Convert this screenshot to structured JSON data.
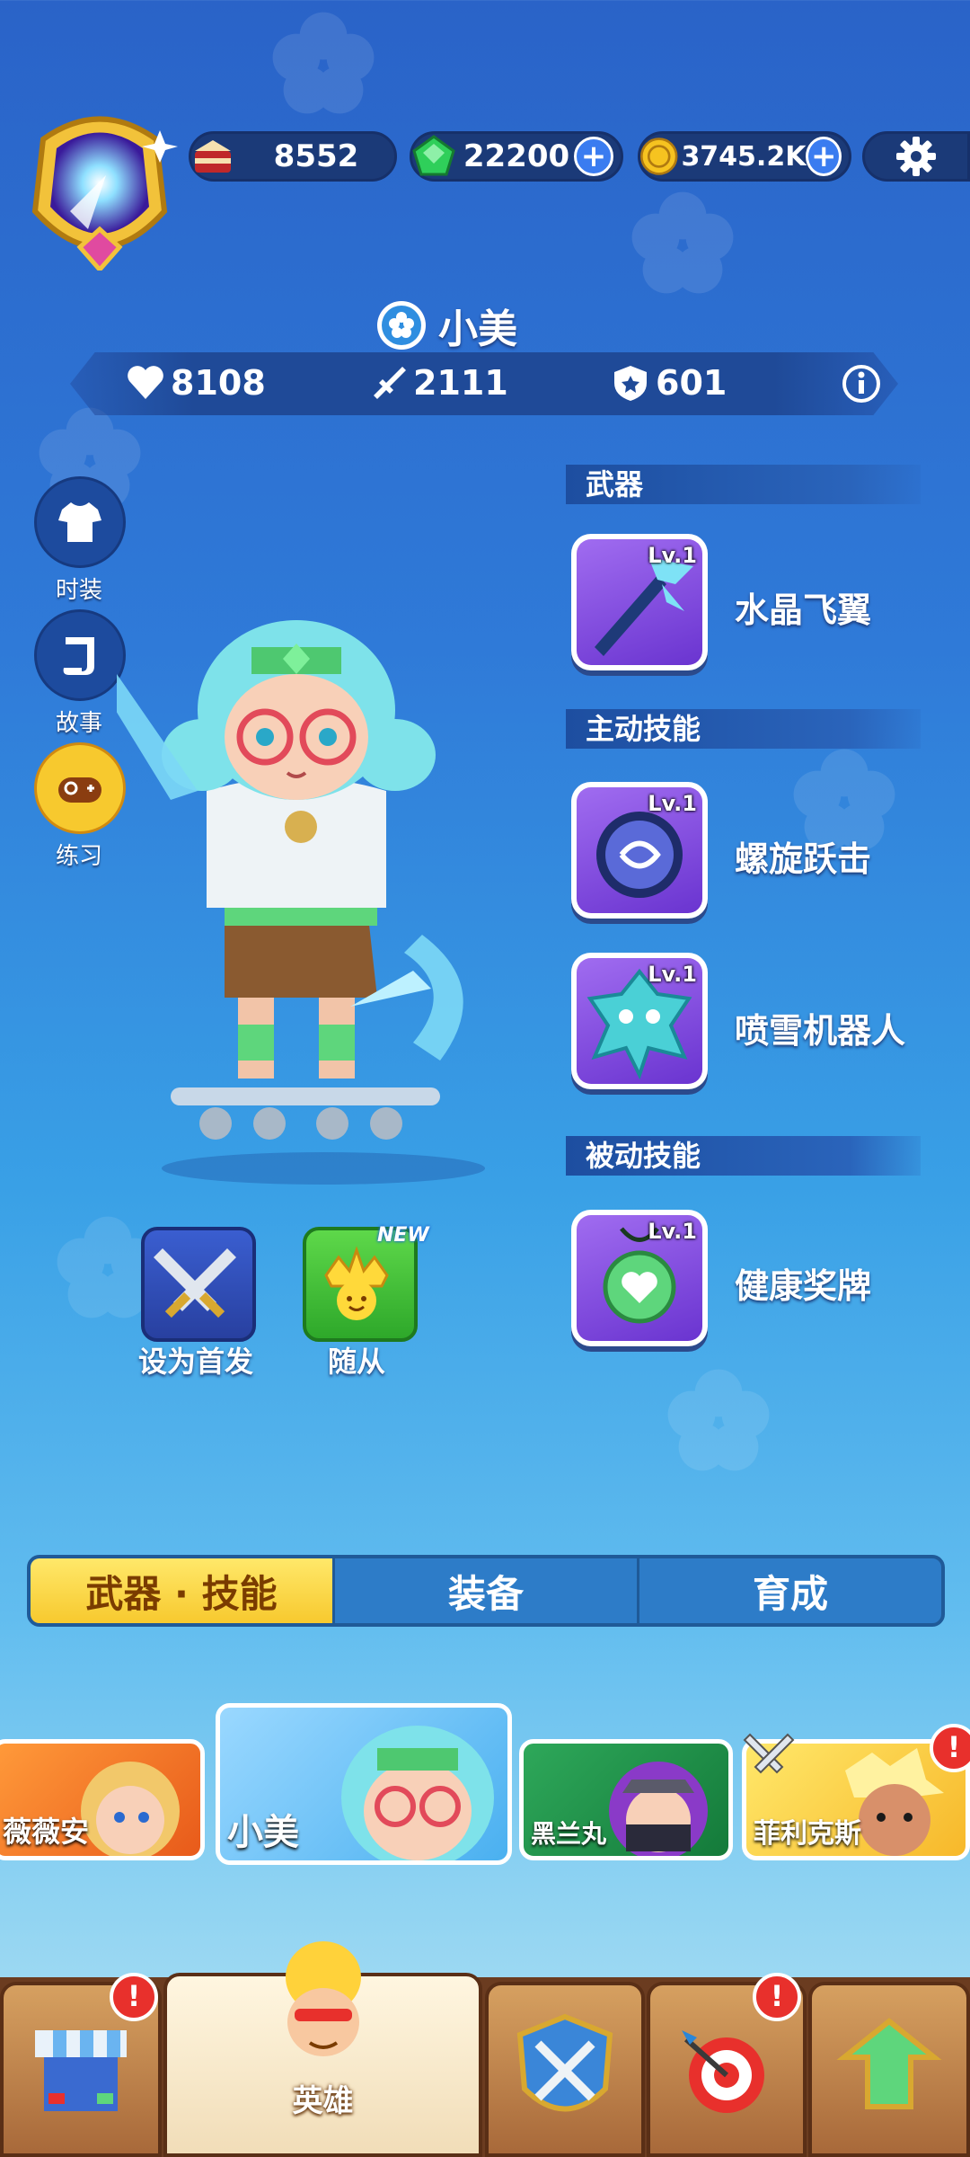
{
  "resources": {
    "cake": "8552",
    "gems": "22200",
    "coins": "3745.2K"
  },
  "hero": {
    "name": "小美",
    "hp": "8108",
    "attack": "2111",
    "defense": "601"
  },
  "side_buttons": {
    "fashion": "时装",
    "story": "故事",
    "practice": "练习"
  },
  "sections": {
    "weapon": "武器",
    "active": "主动技能",
    "passive": "被动技能"
  },
  "skills": [
    {
      "level": "Lv.1",
      "name": "水晶飞翼"
    },
    {
      "level": "Lv.1",
      "name": "螺旋跃击"
    },
    {
      "level": "Lv.1",
      "name": "喷雪机器人"
    },
    {
      "level": "Lv.1",
      "name": "健康奖牌"
    }
  ],
  "actions": {
    "set_first": "设为首发",
    "follower": "随从",
    "new_badge": "NEW"
  },
  "tabs": [
    "武器 · 技能",
    "装备",
    "育成"
  ],
  "roster": [
    {
      "name": "薇薇安"
    },
    {
      "name": "小美"
    },
    {
      "name": "黑兰丸"
    },
    {
      "name": "菲利克斯"
    }
  ],
  "nav": {
    "hero_label": "英雄",
    "badge": "!"
  },
  "colors": {
    "bg_top": "#2a63c8",
    "tab_active": "#f7c92e",
    "badge": "#e8302c"
  }
}
